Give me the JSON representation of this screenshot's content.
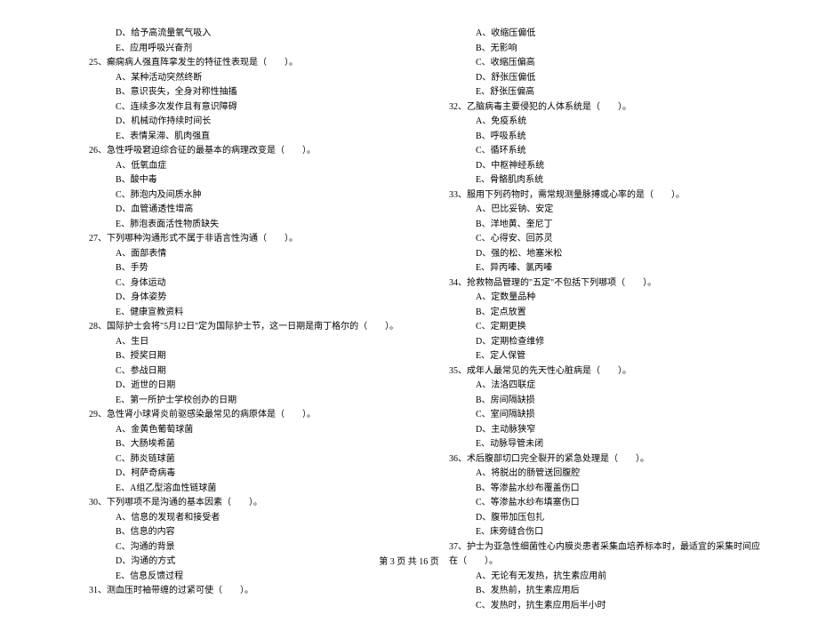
{
  "left": {
    "q24opts": [
      "D、给予高流量氧气吸入",
      "E、应用呼吸兴奋剂"
    ],
    "q25": "25、癫痫病人强直阵挛发生的特征性表现是（　　）。",
    "q25opts": [
      "A、某种活动突然终断",
      "B、意识丧失，全身对称性抽搐",
      "C、连续多次发作且有意识障碍",
      "D、机械动作持续时间长",
      "E、表情呆滞、肌肉强直"
    ],
    "q26": "26、急性呼吸窘迫综合征的最基本的病理改变是（　　）。",
    "q26opts": [
      "A、低氧血症",
      "B、酸中毒",
      "C、肺泡内及间质水肿",
      "D、血管通透性增高",
      "E、肺泡表面活性物质缺失"
    ],
    "q27": "27、下列哪种沟通形式不属于非语言性沟通（　　）。",
    "q27opts": [
      "A、面部表情",
      "B、手势",
      "C、身体运动",
      "D、身体姿势",
      "E、健康宣教资料"
    ],
    "q28": "28、国际护士会将\"5月12日\"定为国际护士节，这一日期是南丁格尔的（　　）。",
    "q28opts": [
      "A、生日",
      "B、授奖日期",
      "C、参战日期",
      "D、逝世的日期",
      "E、第一所护士学校创办的日期"
    ],
    "q29": "29、急性肾小球肾炎前驱感染最常见的病原体是（　　）。",
    "q29opts": [
      "A、金黄色葡萄球菌",
      "B、大肠埃希菌",
      "C、肺炎链球菌",
      "D、柯萨奇病毒",
      "E、A组乙型溶血性链球菌"
    ],
    "q30": "30、下列哪项不是沟通的基本因素（　　）。",
    "q30opts": [
      "A、信息的发现者和接受者",
      "B、信息的内容",
      "C、沟通的背景",
      "D、沟通的方式",
      "E、信息反馈过程"
    ],
    "q31": "31、测血压时袖带缠的过紧可使（　　）。"
  },
  "right": {
    "q31opts": [
      "A、收缩压偏低",
      "B、无影响",
      "C、收缩压偏高",
      "D、舒张压偏低",
      "E、舒张压偏高"
    ],
    "q32": "32、乙脑病毒主要侵犯的人体系统是（　　）。",
    "q32opts": [
      "A、免疫系统",
      "B、呼吸系统",
      "C、循环系统",
      "D、中枢神经系统",
      "E、骨骼肌肉系统"
    ],
    "q33": "33、服用下列药物时，需常规测量脉搏或心率的是（　　）。",
    "q33opts": [
      "A、巴比妥钠、安定",
      "B、洋地黄、奎尼丁",
      "C、心得安、回苏灵",
      "D、强的松、地塞米松",
      "E、异丙嗪、氯丙嗪"
    ],
    "q34": "34、抢救物品管理的\"五定\"不包括下列哪项（　　）。",
    "q34opts": [
      "A、定数量品种",
      "B、定点放置",
      "C、定期更换",
      "D、定期检查维修",
      "E、定人保管"
    ],
    "q35": "35、成年人最常见的先天性心脏病是（　　）。",
    "q35opts": [
      "A、法洛四联症",
      "B、房间隔缺损",
      "C、室间隔缺损",
      "D、主动脉狭窄",
      "E、动脉导管未闭"
    ],
    "q36": "36、术后腹部切口完全裂开的紧急处理是（　　）。",
    "q36opts": [
      "A、将脱出的肠管送回腹腔",
      "B、等渗盐水纱布覆盖伤口",
      "C、等渗盐水纱布填塞伤口",
      "D、腹带加压包扎",
      "E、床旁缝合伤口"
    ],
    "q37": "37、护士为亚急性细菌性心内膜炎患者采集血培养标本时，最适宜的采集时间应在（　　）。",
    "q37opts": [
      "A、无论有无发热，抗生素应用前",
      "B、发热前，抗生素应用后",
      "C、发热时，抗生素应用后半小时"
    ]
  },
  "footer": "第 3 页 共 16 页"
}
